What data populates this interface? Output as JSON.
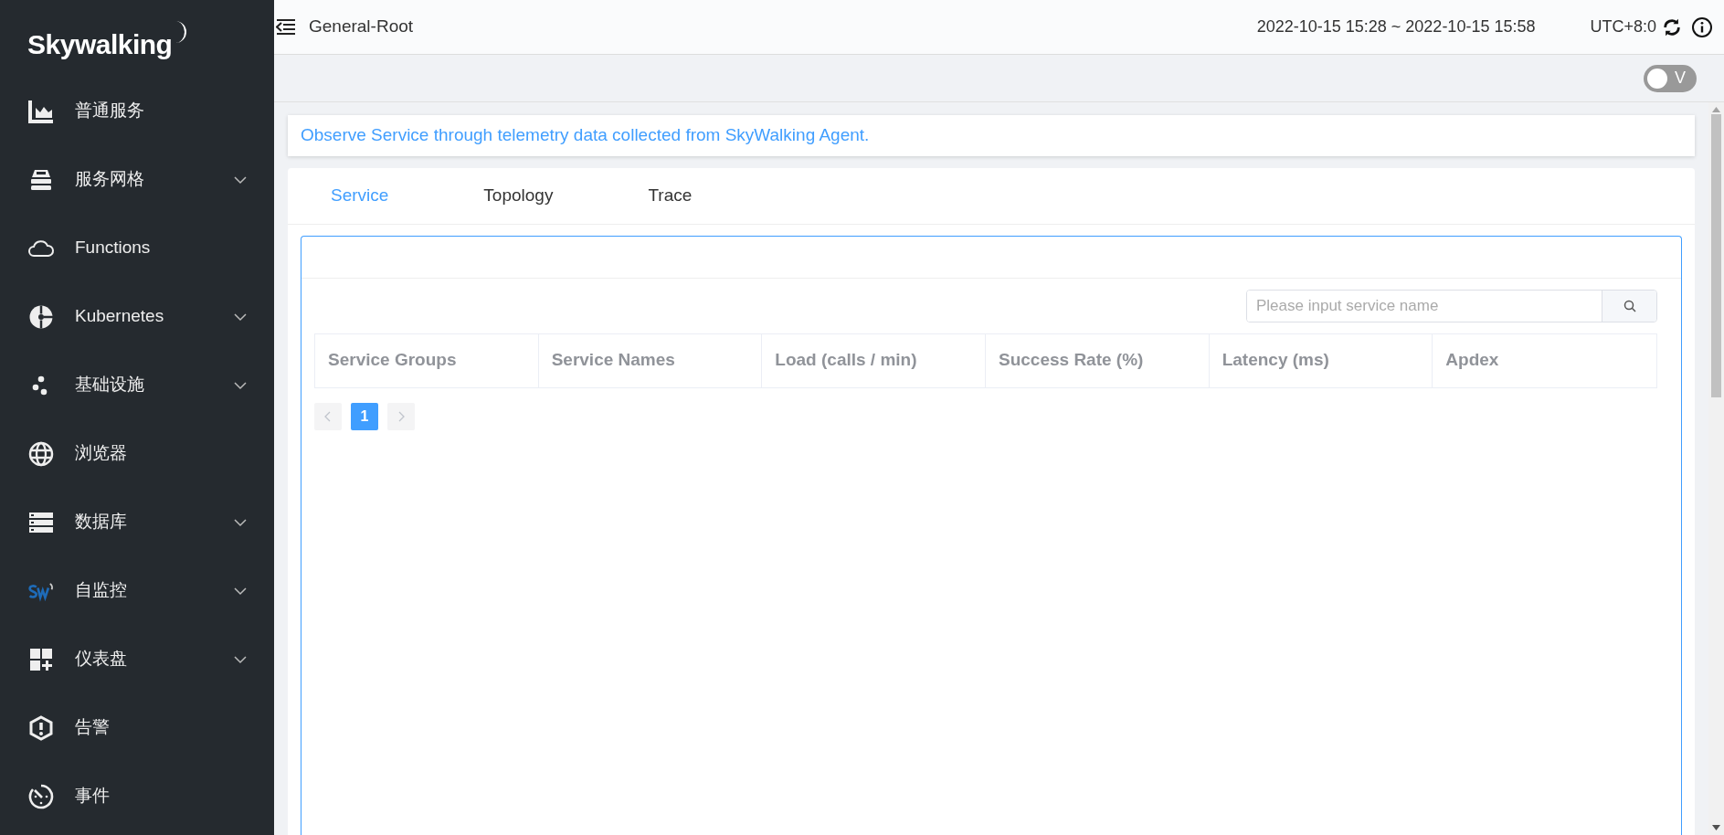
{
  "sidebar": {
    "logo": "Skywalking",
    "items": [
      {
        "label": "普通服务",
        "has_submenu": false
      },
      {
        "label": "服务网格",
        "has_submenu": true
      },
      {
        "label": "Functions",
        "has_submenu": false
      },
      {
        "label": "Kubernetes",
        "has_submenu": true
      },
      {
        "label": "基础设施",
        "has_submenu": true
      },
      {
        "label": "浏览器",
        "has_submenu": false
      },
      {
        "label": "数据库",
        "has_submenu": true
      },
      {
        "label": "自监控",
        "has_submenu": true
      },
      {
        "label": "仪表盘",
        "has_submenu": true
      },
      {
        "label": "告警",
        "has_submenu": false
      },
      {
        "label": "事件",
        "has_submenu": false
      }
    ]
  },
  "header": {
    "title": "General-Root",
    "time_range": "2022-10-15 15:28 ~ 2022-10-15 15:58",
    "timezone": "UTC+8:0"
  },
  "toggle": {
    "label": "V",
    "on": false
  },
  "description": "Observe Service through telemetry data collected from SkyWalking Agent.",
  "tabs": [
    {
      "label": "Service",
      "selected": true
    },
    {
      "label": "Topology",
      "selected": false
    },
    {
      "label": "Trace",
      "selected": false
    }
  ],
  "search": {
    "placeholder": "Please input service name"
  },
  "table": {
    "columns": [
      "Service Groups",
      "Service Names",
      "Load (calls / min)",
      "Success Rate (%)",
      "Latency (ms)",
      "Apdex"
    ]
  },
  "pagination": {
    "pages": [
      {
        "label": "1",
        "selected": true
      }
    ]
  }
}
